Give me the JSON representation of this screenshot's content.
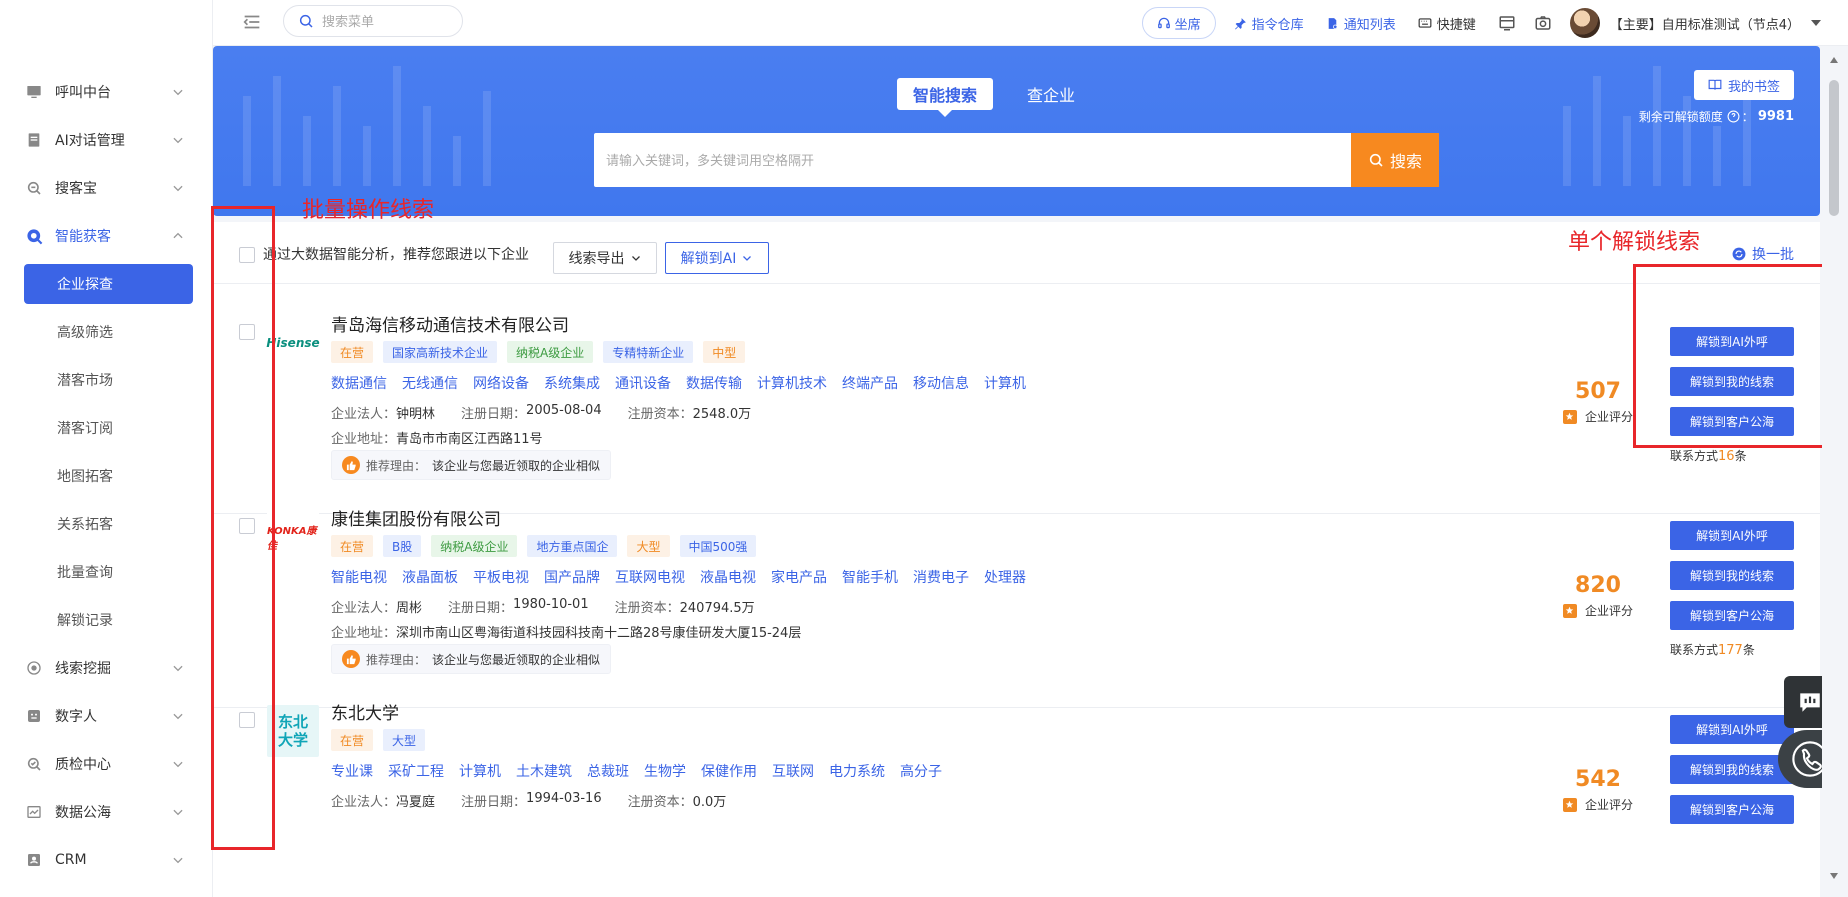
{
  "sidebar": {
    "groups": [
      {
        "label": "呼叫中台",
        "icon": "monitor-icon"
      },
      {
        "label": "AI对话管理",
        "icon": "document-icon"
      },
      {
        "label": "搜客宝",
        "icon": "search-icon"
      },
      {
        "label": "智能获客",
        "icon": "target-icon",
        "open": true
      }
    ],
    "subitems": [
      "企业探查",
      "高级筛选",
      "潜客市场",
      "潜客订阅",
      "地图拓客",
      "关系拓客",
      "批量查询",
      "解锁记录"
    ],
    "active_subitem": "企业探查",
    "groups_after": [
      {
        "label": "线索挖掘",
        "icon": "mine-icon"
      },
      {
        "label": "数字人",
        "icon": "digital-human-icon"
      },
      {
        "label": "质检中心",
        "icon": "inspect-icon"
      },
      {
        "label": "数据公海",
        "icon": "chart-icon"
      },
      {
        "label": "CRM",
        "icon": "crm-icon"
      }
    ]
  },
  "topbar": {
    "search_placeholder": "搜索菜单",
    "seat_label": "坐席",
    "links": [
      "指令仓库",
      "通知列表",
      "快捷键"
    ],
    "user_name": "【主要】自用标准测试（节点4）"
  },
  "hero": {
    "tabs": [
      "智能搜索",
      "查企业"
    ],
    "active_tab": "智能搜索",
    "search_placeholder": "请输入关键词，多关键词用空格隔开",
    "search_button": "搜索",
    "bookmark_label": "我的书签",
    "quota_label": "剩余可解锁额度",
    "quota_value": "9981"
  },
  "toolbar": {
    "text": "通过大数据智能分析，推荐您跟进以下企业",
    "export_label": "线索导出",
    "unlock_ai_label": "解锁到AI",
    "refresh_label": "换一批"
  },
  "labels": {
    "legal": "企业法人：",
    "reg_date": "注册日期：",
    "capital": "注册资本：",
    "address": "企业地址：",
    "reason": "推荐理由：",
    "score": "企业评分",
    "contact_prefix": "联系方式",
    "contact_suffix": "条",
    "btn_ai_call": "解锁到AI外呼",
    "btn_my_leads": "解锁到我的线索",
    "btn_public_sea": "解锁到客户公海"
  },
  "companies": [
    {
      "name": "青岛海信移动通信技术有限公司",
      "logo_text": "Hisense",
      "tags": [
        {
          "t": "在营",
          "c": "orange"
        },
        {
          "t": "国家高新技术企业",
          "c": "blue"
        },
        {
          "t": "纳税A级企业",
          "c": "green"
        },
        {
          "t": "专精特新企业",
          "c": "blue"
        },
        {
          "t": "中型",
          "c": "orange"
        }
      ],
      "keywords": [
        "数据通信",
        "无线通信",
        "网络设备",
        "系统集成",
        "通讯设备",
        "数据传输",
        "计算机技术",
        "终端产品",
        "移动信息",
        "计算机"
      ],
      "legal": "钟明林",
      "reg_date": "2005-08-04",
      "capital": "2548.0万",
      "address": "青岛市市南区江西路11号",
      "reason": "该企业与您最近领取的企业相似",
      "score": "507",
      "contact_count": "16"
    },
    {
      "name": "康佳集团股份有限公司",
      "logo_text": "KONKA康佳",
      "tags": [
        {
          "t": "在营",
          "c": "orange"
        },
        {
          "t": "B股",
          "c": "blue"
        },
        {
          "t": "纳税A级企业",
          "c": "green"
        },
        {
          "t": "地方重点国企",
          "c": "blue"
        },
        {
          "t": "大型",
          "c": "orange"
        },
        {
          "t": "中国500强",
          "c": "blue"
        }
      ],
      "keywords": [
        "智能电视",
        "液晶面板",
        "平板电视",
        "国产品牌",
        "互联网电视",
        "液晶电视",
        "家电产品",
        "智能手机",
        "消费电子",
        "处理器"
      ],
      "legal": "周彬",
      "reg_date": "1980-10-01",
      "capital": "240794.5万",
      "address": "深圳市南山区粤海街道科技园科技南十二路28号康佳研发大厦15-24层",
      "reason": "该企业与您最近领取的企业相似",
      "score": "820",
      "contact_count": "177"
    },
    {
      "name": "东北大学",
      "logo_text": "东北大学",
      "tags": [
        {
          "t": "在营",
          "c": "orange"
        },
        {
          "t": "大型",
          "c": "blue"
        }
      ],
      "keywords": [
        "专业课",
        "采矿工程",
        "计算机",
        "土木建筑",
        "总裁班",
        "生物学",
        "保健作用",
        "互联网",
        "电力系统",
        "高分子"
      ],
      "legal": "冯夏庭",
      "reg_date": "1994-03-16",
      "capital": "0.0万",
      "score": "542"
    }
  ],
  "annotations": {
    "batch": "批量操作线索",
    "single": "单个解锁线索"
  }
}
